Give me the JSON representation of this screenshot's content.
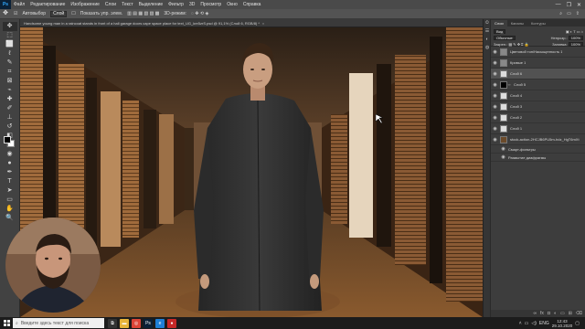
{
  "menubar": {
    "logo": "Ps",
    "items": [
      "Файл",
      "Редактирование",
      "Изображение",
      "Слои",
      "Текст",
      "Выделение",
      "Фильтр",
      "3D",
      "Просмотр",
      "Окно",
      "Справка"
    ],
    "controls": [
      "—",
      "❐",
      "✕"
    ]
  },
  "options": {
    "autoselect": "Автовыбор",
    "target": "Слой",
    "show_controls": "Показать упр. элем.",
    "mode3d": "3D-режим:",
    "search_icon": "search-icon",
    "workspace_icon": "workspace-icon",
    "share_icon": "share-icon"
  },
  "document": {
    "title": "Handsome young man in a raincoat stands in front of a hall garage doors cape space place for text_UG_kre5zrS.psd @ 91,1% (Слой 6, RGB/8) *",
    "close": "×"
  },
  "tools": [
    {
      "icon": "move-tool-icon",
      "glyph": "✥"
    },
    {
      "icon": "artboard-tool-icon",
      "glyph": "⬚"
    },
    {
      "icon": "marquee-tool-icon",
      "glyph": "⬜"
    },
    {
      "icon": "lasso-tool-icon",
      "glyph": "ℓ"
    },
    {
      "icon": "quick-select-tool-icon",
      "glyph": "✎"
    },
    {
      "icon": "crop-tool-icon",
      "glyph": "⌗"
    },
    {
      "icon": "frame-tool-icon",
      "glyph": "⊠"
    },
    {
      "icon": "eyedropper-tool-icon",
      "glyph": "⌁"
    },
    {
      "icon": "healing-tool-icon",
      "glyph": "✚"
    },
    {
      "icon": "brush-tool-icon",
      "glyph": "✐"
    },
    {
      "icon": "stamp-tool-icon",
      "glyph": "⊥"
    },
    {
      "icon": "history-brush-icon",
      "glyph": "↺"
    },
    {
      "icon": "eraser-tool-icon",
      "glyph": "◧"
    },
    {
      "icon": "gradient-tool-icon",
      "glyph": "▤"
    },
    {
      "icon": "blur-tool-icon",
      "glyph": "◉"
    },
    {
      "icon": "dodge-tool-icon",
      "glyph": "●"
    },
    {
      "icon": "pen-tool-icon",
      "glyph": "✒"
    },
    {
      "icon": "type-tool-icon",
      "glyph": "T"
    },
    {
      "icon": "path-select-tool-icon",
      "glyph": "➤"
    },
    {
      "icon": "shape-tool-icon",
      "glyph": "▭"
    },
    {
      "icon": "hand-tool-icon",
      "glyph": "✋"
    },
    {
      "icon": "zoom-tool-icon",
      "glyph": "🔍"
    }
  ],
  "colors": {
    "foreground": "#000000",
    "background": "#ffffff"
  },
  "panel": {
    "tabs": [
      "Слои",
      "Каналы",
      "Контуры"
    ],
    "kind_label": "Вид",
    "blend_mode": "Обычные",
    "opacity_label": "Непрозр.:",
    "opacity_value": "100%",
    "lock_label": "Закреп.:",
    "fill_label": "Заливка:",
    "fill_value": "100%",
    "layers": [
      {
        "name": "Цветовой тон/Насыщенность 1",
        "thumb": "adj",
        "visible": true
      },
      {
        "name": "Кривые 1",
        "thumb": "adj",
        "visible": true
      },
      {
        "name": "Слой 6",
        "thumb": "grid",
        "visible": true,
        "selected": true
      },
      {
        "name": "Слой 5",
        "thumb": "mask",
        "visible": true
      },
      {
        "name": "Слой 4",
        "thumb": "grid",
        "visible": true
      },
      {
        "name": "Слой 3",
        "thumb": "grid",
        "visible": true
      },
      {
        "name": "Слой 2",
        "thumb": "grid",
        "visible": true
      },
      {
        "name": "Слой 1",
        "thumb": "grid",
        "visible": true
      },
      {
        "name": "stock-action-2HCJB6PU5m-hdz_HgT6mXt",
        "thumb": "photo",
        "visible": true
      }
    ],
    "sublayers": [
      {
        "name": "Смарт-фильтры"
      },
      {
        "name": "Размытие диафрагмы"
      }
    ],
    "footer_icons": [
      "link-icon",
      "fx-icon",
      "mask-icon",
      "adjustment-icon",
      "folder-icon",
      "new-layer-icon",
      "trash-icon"
    ]
  },
  "taskbar": {
    "search_placeholder": "Введите здесь текст для поиска",
    "apps": [
      {
        "icon": "task-view-icon",
        "color": "#333333",
        "glyph": "⧉"
      },
      {
        "icon": "explorer-icon",
        "color": "#e8b43a",
        "glyph": "▬"
      },
      {
        "icon": "chrome-icon",
        "color": "#db4437",
        "glyph": "◎"
      },
      {
        "icon": "photoshop-icon",
        "color": "#0b2137",
        "glyph": "Ps"
      },
      {
        "icon": "edge-icon",
        "color": "#1e7fd6",
        "glyph": "e"
      },
      {
        "icon": "record-icon",
        "color": "#c62828",
        "glyph": "●"
      }
    ],
    "lang": "ENG",
    "time": "12:43",
    "date": "29.10.2020"
  }
}
